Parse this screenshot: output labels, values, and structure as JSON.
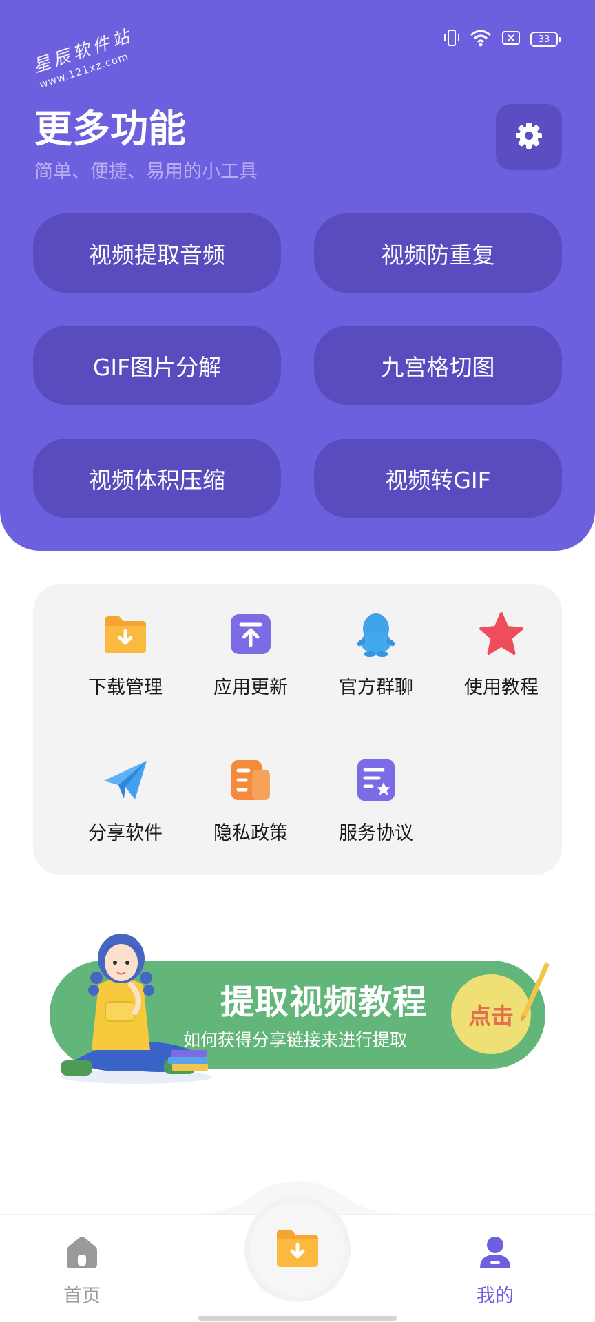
{
  "status_bar": {
    "battery": "33",
    "icons": [
      "vibrate-icon",
      "wifi-icon",
      "no-sim-icon",
      "battery-icon"
    ]
  },
  "watermark": {
    "title": "星辰软件站",
    "url": "www.121xz.com"
  },
  "header": {
    "title": "更多功能",
    "subtitle": "简单、便捷、易用的小工具",
    "settings_icon": "gear-icon",
    "background_color": "#6d60df"
  },
  "functions": [
    {
      "label": "视频提取音频"
    },
    {
      "label": "视频防重复"
    },
    {
      "label": "GIF图片分解"
    },
    {
      "label": "九宫格切图"
    },
    {
      "label": "视频体积压缩"
    },
    {
      "label": "视频转GIF"
    }
  ],
  "tools": [
    {
      "label": "下载管理",
      "icon": "download-folder-icon"
    },
    {
      "label": "应用更新",
      "icon": "upload-icon"
    },
    {
      "label": "官方群聊",
      "icon": "qq-penguin-icon"
    },
    {
      "label": "使用教程",
      "icon": "star-icon"
    },
    {
      "label": "分享软件",
      "icon": "paper-plane-icon"
    },
    {
      "label": "隐私政策",
      "icon": "document-icon"
    },
    {
      "label": "服务协议",
      "icon": "agreement-icon"
    }
  ],
  "banner": {
    "title": "提取视频教程",
    "subtitle": "如何获得分享链接来进行提取",
    "cta": "点击"
  },
  "bottom_nav": {
    "home_label": "首页",
    "mine_label": "我的",
    "active_color": "#6d60df",
    "inactive_color": "#9a9a9a"
  }
}
